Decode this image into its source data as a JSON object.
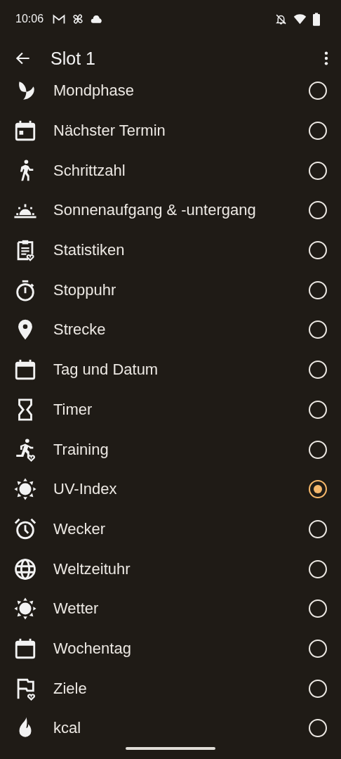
{
  "status_bar": {
    "time": "10:06"
  },
  "app_bar": {
    "title": "Slot 1"
  },
  "options": [
    {
      "label": "Mondphase",
      "selected": false
    },
    {
      "label": "Nächster Termin",
      "selected": false
    },
    {
      "label": "Schrittzahl",
      "selected": false
    },
    {
      "label": "Sonnenaufgang & -untergang",
      "selected": false
    },
    {
      "label": "Statistiken",
      "selected": false
    },
    {
      "label": "Stoppuhr",
      "selected": false
    },
    {
      "label": "Strecke",
      "selected": false
    },
    {
      "label": "Tag und Datum",
      "selected": false
    },
    {
      "label": "Timer",
      "selected": false
    },
    {
      "label": "Training",
      "selected": false
    },
    {
      "label": "UV-Index",
      "selected": true
    },
    {
      "label": "Wecker",
      "selected": false
    },
    {
      "label": "Weltzeituhr",
      "selected": false
    },
    {
      "label": "Wetter",
      "selected": false
    },
    {
      "label": "Wochentag",
      "selected": false
    },
    {
      "label": "Ziele",
      "selected": false
    },
    {
      "label": "kcal",
      "selected": false
    }
  ]
}
